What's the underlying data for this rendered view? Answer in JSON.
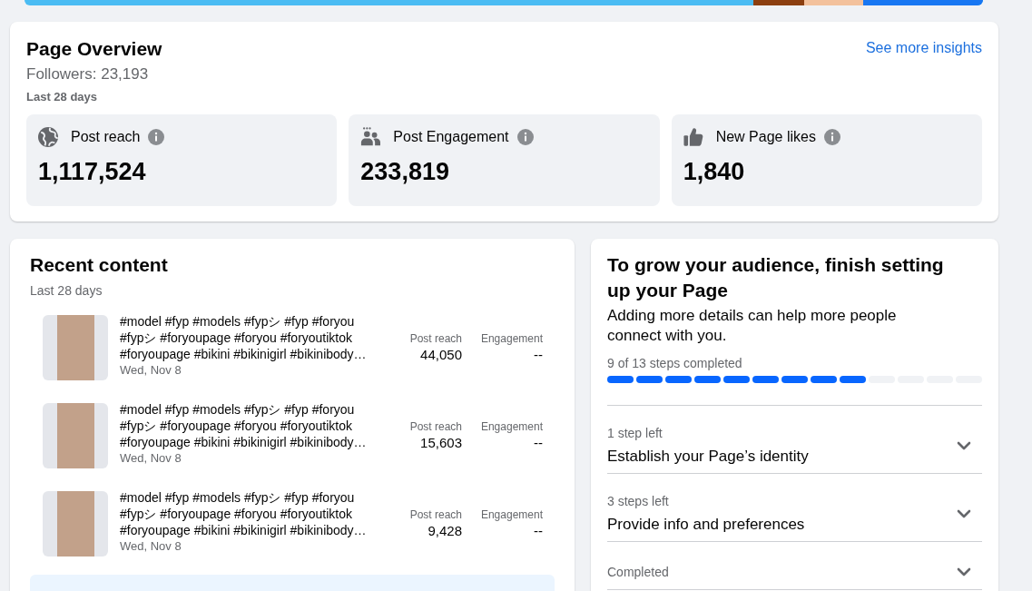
{
  "page_overview": {
    "title": "Page Overview",
    "link": "See more insights",
    "followers": "Followers: 23,193",
    "period": "Last 28 days",
    "stats": [
      {
        "label": "Post reach",
        "value": "1,117,524"
      },
      {
        "label": "Post Engagement",
        "value": "233,819"
      },
      {
        "label": "New Page likes",
        "value": "1,840"
      }
    ]
  },
  "recent_content": {
    "title": "Recent content",
    "period": "Last 28 days",
    "posts": [
      {
        "caption": "#model #fyp #models #fypシ #fyp #foryou #fypシ #foryoupage #foryou #foryoutiktok #foryoupage #bikini #bikinigirl #bikinibody…",
        "date": "Wed, Nov 8",
        "reach_label": "Post reach",
        "reach": "44,050",
        "engagement_label": "Engagement",
        "engagement": "--"
      },
      {
        "caption": "#model #fyp #models #fypシ #fyp #foryou #fypシ #foryoupage #foryou #foryoutiktok #foryoupage #bikini #bikinigirl #bikinibody…",
        "date": "Wed, Nov 8",
        "reach_label": "Post reach",
        "reach": "15,603",
        "engagement_label": "Engagement",
        "engagement": "--"
      },
      {
        "caption": "#model #fyp #models #fypシ #fyp #foryou #fypシ #foryoupage #foryou #foryoutiktok #foryoupage #bikini #bikinigirl #bikinibody…",
        "date": "Wed, Nov 8",
        "reach_label": "Post reach",
        "reach": "9,428",
        "engagement_label": "Engagement",
        "engagement": "--"
      }
    ]
  },
  "setup": {
    "title": "To grow your audience, finish setting up your Page",
    "subtitle": "Adding more details can help more people connect with you.",
    "progress_label": "9 of 13 steps completed",
    "segments": [
      {
        "filled": true
      },
      {
        "filled": true
      },
      {
        "filled": true
      },
      {
        "filled": true
      },
      {
        "filled": true
      },
      {
        "filled": true
      },
      {
        "filled": true
      },
      {
        "filled": true
      },
      {
        "filled": true
      },
      {
        "filled": false
      },
      {
        "filled": false
      },
      {
        "filled": false
      },
      {
        "filled": false
      }
    ],
    "sections": [
      {
        "status": "1 step left",
        "title": "Establish your Page’s identity",
        "expanded": false
      },
      {
        "status": "3 steps left",
        "title": "Provide info and preferences",
        "expanded": false
      },
      {
        "status": "Completed",
        "expanded": false
      }
    ]
  }
}
